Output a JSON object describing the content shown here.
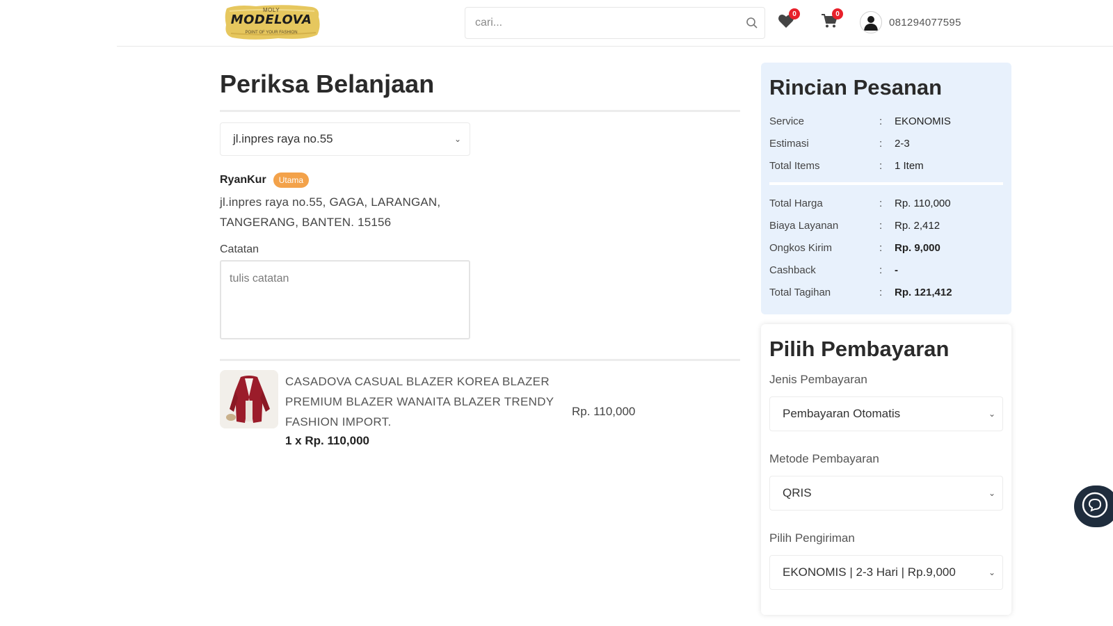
{
  "header": {
    "logo_top": "MOLY",
    "logo_main": "MODELOVA",
    "logo_tag": "POINT OF YOUR FASHION",
    "search_placeholder": "cari...",
    "wishlist_count": "0",
    "cart_count": "0",
    "phone": "081294077595"
  },
  "page": {
    "title": "Periksa Belanjaan",
    "address_select": "jl.inpres raya no.55",
    "recipient_name": "RyanKur",
    "recipient_tag": "Utama",
    "address_line1": "jl.inpres raya no.55, GAGA, LARANGAN,",
    "address_line2": "TANGERANG, BANTEN. 15156",
    "notes_label": "Catatan",
    "notes_placeholder": "tulis catatan"
  },
  "product": {
    "name": "CASADOVA CASUAL BLAZER KOREA BLAZER PREMIUM BLAZER WANAITA BLAZER TRENDY FASHION IMPORT.",
    "qty_price": "1 x Rp. 110,000",
    "total": "Rp. 110,000"
  },
  "summary": {
    "title": "Rincian Pesanan",
    "rows_top": [
      {
        "key": "Service",
        "value": "EKONOMIS"
      },
      {
        "key": "Estimasi",
        "value": "2-3"
      },
      {
        "key": "Total Items",
        "value": "1 Item"
      }
    ],
    "rows_bottom": [
      {
        "key": "Total Harga",
        "value": "Rp. 110,000"
      },
      {
        "key": "Biaya Layanan",
        "value": "Rp. 2,412"
      },
      {
        "key": "Ongkos Kirim",
        "value": "Rp. 9,000"
      },
      {
        "key": "Cashback",
        "value": "-"
      },
      {
        "key": "Total Tagihan",
        "value": "Rp. 121,412"
      }
    ],
    "separator": ":"
  },
  "payment": {
    "title": "Pilih Pembayaran",
    "type_label": "Jenis Pembayaran",
    "type_value": "Pembayaran Otomatis",
    "method_label": "Metode Pembayaran",
    "method_value": "QRIS",
    "shipping_label": "Pilih Pengiriman",
    "shipping_value": "EKONOMIS | 2-3 Hari | Rp.9,000"
  },
  "colors": {
    "badge": "#e8202a",
    "tag": "#f3a24a",
    "summary_bg": "#e8f1fc",
    "chat_bg": "#1f2d3d"
  },
  "icons": [
    "search-icon",
    "heart-icon",
    "cart-icon",
    "user-icon",
    "chevron-down-icon",
    "chat-icon"
  ]
}
